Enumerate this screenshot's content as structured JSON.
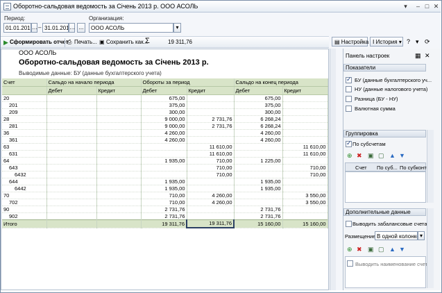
{
  "window": {
    "title": "Оборотно-сальдовая ведомость за Січень 2013 р. ООО АСОЛЬ"
  },
  "filters": {
    "period_label": "Период:",
    "date_from": "01.01.2013",
    "date_sep": "–",
    "date_to": "31.01.2013",
    "org_label": "Организация:",
    "org_value": "ООО АСОЛЬ"
  },
  "toolbar": {
    "generate": "Сформировать отчет",
    "print": "Печать...",
    "save_as": "Сохранить как...",
    "sum_symbol": "Σ",
    "sum_value": "19 311,76",
    "settings": "Настройка",
    "history": "История"
  },
  "report": {
    "org": "ООО АСОЛЬ",
    "title": "Оборотно-сальдовая ведомость за Січень 2013 р.",
    "subtitle": "Выводимые данные:  БУ (данные бухгалтерского учета)",
    "headers": {
      "account": "Счет",
      "opening": "Сальдо на начало периода",
      "turnover": "Обороты за период",
      "closing": "Сальдо на конец периода",
      "debit": "Дебет",
      "credit": "Кредит"
    },
    "rows": [
      {
        "acc": "20",
        "lvl": 0,
        "od": "",
        "oc": "",
        "td": "675,00",
        "tc": "",
        "cd": "675,00",
        "cc": ""
      },
      {
        "acc": "201",
        "lvl": 1,
        "od": "",
        "oc": "",
        "td": "375,00",
        "tc": "",
        "cd": "375,00",
        "cc": ""
      },
      {
        "acc": "209",
        "lvl": 1,
        "od": "",
        "oc": "",
        "td": "300,00",
        "tc": "",
        "cd": "300,00",
        "cc": ""
      },
      {
        "acc": "28",
        "lvl": 0,
        "od": "",
        "oc": "",
        "td": "9 000,00",
        "tc": "2 731,76",
        "cd": "6 268,24",
        "cc": ""
      },
      {
        "acc": "281",
        "lvl": 1,
        "od": "",
        "oc": "",
        "td": "9 000,00",
        "tc": "2 731,76",
        "cd": "6 268,24",
        "cc": ""
      },
      {
        "acc": "36",
        "lvl": 0,
        "od": "",
        "oc": "",
        "td": "4 260,00",
        "tc": "",
        "cd": "4 260,00",
        "cc": ""
      },
      {
        "acc": "361",
        "lvl": 1,
        "od": "",
        "oc": "",
        "td": "4 260,00",
        "tc": "",
        "cd": "4 260,00",
        "cc": ""
      },
      {
        "acc": "63",
        "lvl": 0,
        "od": "",
        "oc": "",
        "td": "",
        "tc": "11 610,00",
        "cd": "",
        "cc": "11 610,00"
      },
      {
        "acc": "631",
        "lvl": 1,
        "od": "",
        "oc": "",
        "td": "",
        "tc": "11 610,00",
        "cd": "",
        "cc": "11 610,00"
      },
      {
        "acc": "64",
        "lvl": 0,
        "od": "",
        "oc": "",
        "td": "1 935,00",
        "tc": "710,00",
        "cd": "1 225,00",
        "cc": ""
      },
      {
        "acc": "643",
        "lvl": 1,
        "od": "",
        "oc": "",
        "td": "",
        "tc": "710,00",
        "cd": "",
        "cc": "710,00"
      },
      {
        "acc": "6432",
        "lvl": 2,
        "od": "",
        "oc": "",
        "td": "",
        "tc": "710,00",
        "cd": "",
        "cc": "710,00"
      },
      {
        "acc": "644",
        "lvl": 1,
        "od": "",
        "oc": "",
        "td": "1 935,00",
        "tc": "",
        "cd": "1 935,00",
        "cc": ""
      },
      {
        "acc": "6442",
        "lvl": 2,
        "od": "",
        "oc": "",
        "td": "1 935,00",
        "tc": "",
        "cd": "1 935,00",
        "cc": ""
      },
      {
        "acc": "70",
        "lvl": 0,
        "od": "",
        "oc": "",
        "td": "710,00",
        "tc": "4 260,00",
        "cd": "",
        "cc": "3 550,00"
      },
      {
        "acc": "702",
        "lvl": 1,
        "od": "",
        "oc": "",
        "td": "710,00",
        "tc": "4 260,00",
        "cd": "",
        "cc": "3 550,00"
      },
      {
        "acc": "90",
        "lvl": 0,
        "od": "",
        "oc": "",
        "td": "2 731,76",
        "tc": "",
        "cd": "2 731,76",
        "cc": ""
      },
      {
        "acc": "902",
        "lvl": 1,
        "od": "",
        "oc": "",
        "td": "2 731,76",
        "tc": "",
        "cd": "2 731,76",
        "cc": ""
      }
    ],
    "total": {
      "label": "Итого",
      "td": "19 311,76",
      "tc": "19 311,76",
      "cd": "15 160,00",
      "cc": "15 160,00"
    }
  },
  "panel": {
    "title": "Панель настроек",
    "indicators_title": "Показатели",
    "indicators": [
      {
        "label": "БУ (данные бухгалтерского уч...",
        "checked": true
      },
      {
        "label": "НУ (данные налогового учета)",
        "checked": false
      },
      {
        "label": "Разница (БУ - НУ)",
        "checked": false
      },
      {
        "label": "Валютная сумма",
        "checked": false
      }
    ],
    "grouping_title": "Группировка",
    "by_subaccounts": "По субсчетам",
    "group_cols": [
      "Счет",
      "По суб...",
      "По субконто"
    ],
    "extra_title": "Дополнительные данные",
    "offbalance": "Выводить забалансовые счета",
    "placement_label": "Размещение:",
    "placement_value": "В одной колонке",
    "show_name": "Выводить наименование счета"
  }
}
